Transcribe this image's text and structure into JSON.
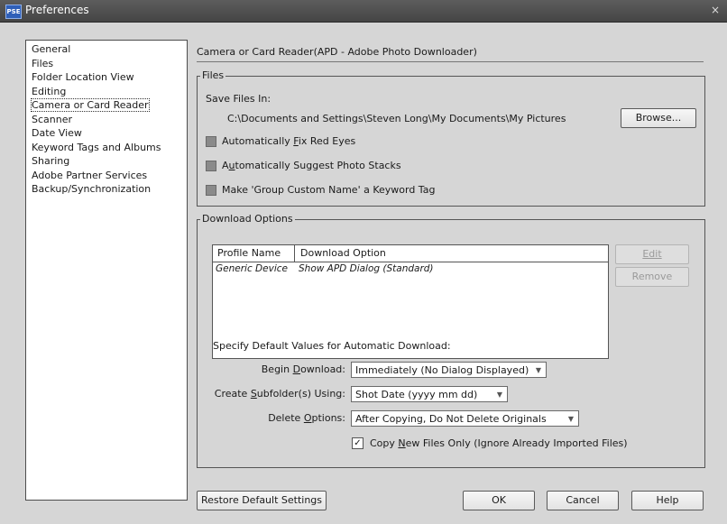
{
  "window": {
    "title": "Preferences",
    "icon_text": "PSE",
    "close_glyph": "×"
  },
  "sidebar": {
    "items": [
      {
        "label": "General"
      },
      {
        "label": "Files"
      },
      {
        "label": "Folder Location View"
      },
      {
        "label": "Editing"
      },
      {
        "label": "Camera or Card Reader",
        "selected": true
      },
      {
        "label": "Scanner"
      },
      {
        "label": "Date View"
      },
      {
        "label": "Keyword Tags and Albums"
      },
      {
        "label": "Sharing"
      },
      {
        "label": "Adobe Partner Services"
      },
      {
        "label": "Backup/Synchronization"
      }
    ]
  },
  "main": {
    "header": "Camera or Card Reader(APD - Adobe Photo Downloader)",
    "files_group": {
      "legend": "Files",
      "save_label": "Save Files In:",
      "save_path": "C:\\Documents and Settings\\Steven Long\\My Documents\\My Pictures",
      "browse_label": "Browse...",
      "checkboxes": [
        {
          "pre": "Automatically ",
          "key": "F",
          "post": "ix Red Eyes",
          "checked": false
        },
        {
          "pre": "A",
          "key": "u",
          "post": "tomatically Suggest Photo Stacks",
          "checked": false
        },
        {
          "pre": "",
          "key": "",
          "post": "Make 'Group Custom Name' a Keyword Tag",
          "checked": false
        }
      ]
    },
    "download_group": {
      "legend": "Download Options",
      "table": {
        "columns": [
          "Profile Name",
          "Download Option"
        ],
        "rows": [
          [
            "Generic Device",
            "Show APD Dialog (Standard)"
          ]
        ]
      },
      "edit_label": "Edit",
      "remove_label": "Remove",
      "defaults_label": "Specify Default Values for Automatic Download:",
      "begin_download": {
        "label_pre": "Begin ",
        "label_key": "D",
        "label_post": "ownload:",
        "value": "Immediately (No Dialog Displayed)"
      },
      "subfolder": {
        "label_pre": "Create ",
        "label_key": "S",
        "label_post": "ubfolder(s) Using:",
        "value": "Shot Date (yyyy mm dd)"
      },
      "delete_options": {
        "label_pre": "Delete ",
        "label_key": "O",
        "label_post": "ptions:",
        "value": "After Copying, Do Not Delete Originals"
      },
      "copy_new": {
        "pre": "Copy ",
        "key": "N",
        "post": "ew Files Only (Ignore Already Imported Files)",
        "checked": true,
        "check_glyph": "✓"
      }
    }
  },
  "footer": {
    "restore_label": "Restore Default Settings",
    "ok_label": "OK",
    "cancel_label": "Cancel",
    "help_label": "Help"
  },
  "dropdown_glyph": "▼"
}
